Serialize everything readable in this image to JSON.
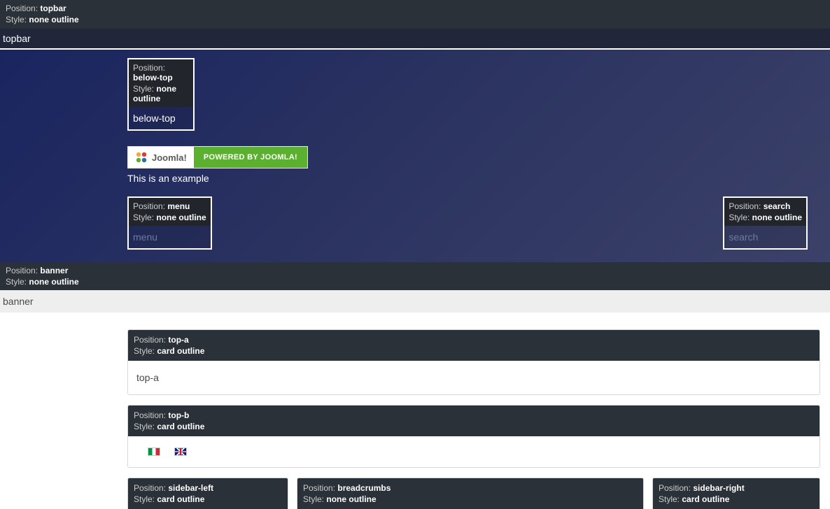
{
  "labels": {
    "position": "Position:",
    "style": "Style:"
  },
  "topbar": {
    "position": "topbar",
    "style": "none outline",
    "body": "topbar"
  },
  "belowTop": {
    "position": "below-top",
    "style": "none outline",
    "body": "below-top"
  },
  "logo": {
    "brand": "Joomla!",
    "powered": "POWERED BY JOOMLA!",
    "caption": "This is an example"
  },
  "menu": {
    "position": "menu",
    "style": "none outline",
    "body": "menu"
  },
  "search": {
    "position": "search",
    "style": "none outline",
    "body": "search"
  },
  "banner": {
    "position": "banner",
    "style": "none outline",
    "body": "banner"
  },
  "topA": {
    "position": "top-a",
    "style": "card outline",
    "body": "top-a"
  },
  "topB": {
    "position": "top-b",
    "style": "card outline"
  },
  "sidebarLeft": {
    "position": "sidebar-left",
    "style": "card outline"
  },
  "breadcrumbs": {
    "position": "breadcrumbs",
    "style": "none outline"
  },
  "sidebarRight": {
    "position": "sidebar-right",
    "style": "card outline"
  },
  "flags": {
    "it": "Italian",
    "gb": "English (UK)"
  }
}
